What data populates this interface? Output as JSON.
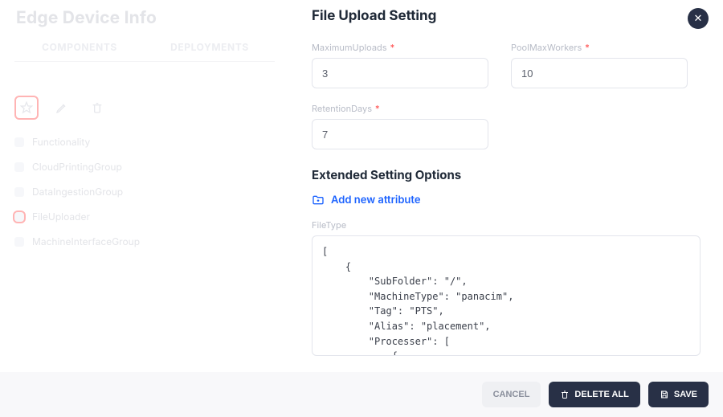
{
  "page_title": "Edge Device Info",
  "tabs": {
    "components": "COMPONENTS",
    "deployments": "DEPLOYMENTS"
  },
  "sidebar": {
    "items": [
      {
        "label": "Functionality",
        "marked": false
      },
      {
        "label": "CloudPrintingGroup",
        "marked": false
      },
      {
        "label": "DataIngestionGroup",
        "marked": false
      },
      {
        "label": "FileUploader",
        "marked": true
      },
      {
        "label": "MachineInterfaceGroup",
        "marked": false
      }
    ]
  },
  "panel": {
    "title": "File Upload Setting",
    "fields": {
      "maximum_uploads": {
        "label": "MaximumUploads",
        "value": "3",
        "required": true
      },
      "pool_max_workers": {
        "label": "PoolMaxWorkers",
        "value": "10",
        "required": true
      },
      "retention_days": {
        "label": "RetentionDays",
        "value": "7",
        "required": true
      }
    },
    "extended_title": "Extended Setting Options",
    "add_attribute_label": "Add new attribute",
    "filetype_label": "FileType",
    "filetype_value": "[\n    {\n        \"SubFolder\": \"/\",\n        \"MachineType\": \"panacim\",\n        \"Tag\": \"PTS\",\n        \"Alias\": \"placement\",\n        \"Processer\": [\n            {\n                \"Extension\": \".xml\",\n                \"Parser\": \"panacim\"\n            }\n        ]"
  },
  "footer": {
    "cancel": "CANCEL",
    "delete_all": "DELETE ALL",
    "save": "SAVE"
  }
}
